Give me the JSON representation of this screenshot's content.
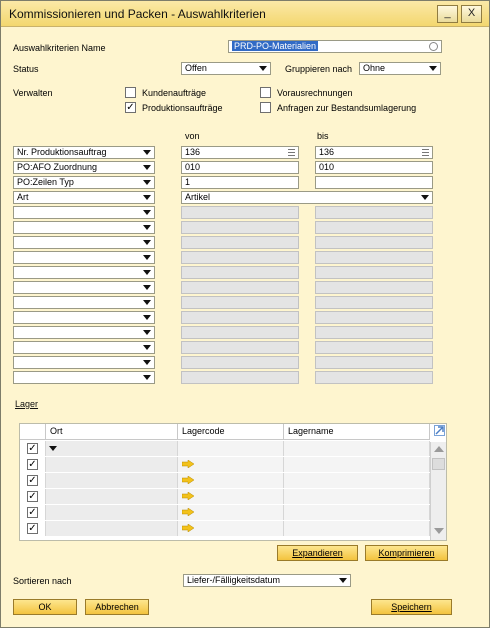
{
  "window": {
    "title": "Kommissionieren und Packen - Auswahlkriterien",
    "minimize": "_",
    "close": "X"
  },
  "criteria_name": {
    "label": "Auswahlkriterien Name",
    "value": "PRD-PO-Materialien"
  },
  "status": {
    "label": "Status",
    "value": "Offen"
  },
  "group": {
    "label": "Gruppieren nach",
    "value": "Ohne"
  },
  "manage": {
    "label": "Verwalten",
    "options": [
      {
        "label": "Kundenaufträge",
        "checked": false
      },
      {
        "label": "Produktionsaufträge",
        "checked": true
      },
      {
        "label": "Vorausrechnungen",
        "checked": false
      },
      {
        "label": "Anfragen zur Bestandsumlagerung",
        "checked": false
      }
    ]
  },
  "range": {
    "from_label": "von",
    "to_label": "bis",
    "rows": [
      {
        "field": "Nr. Produktionsauftrag",
        "from": "136",
        "to": "136"
      },
      {
        "field": "PO:AFO Zuordnung",
        "from": "010",
        "to": "010"
      },
      {
        "field": "PO:Zeilen Typ",
        "from": "1",
        "to": ""
      },
      {
        "field": "Art",
        "value": "Artikel"
      }
    ]
  },
  "warehouse": {
    "label": "Lager",
    "columns": [
      "Ort",
      "Lagercode",
      "Lagername"
    ],
    "rows": 6
  },
  "buttons": {
    "expand": "Expandieren",
    "compress": "Komprimieren",
    "ok": "OK",
    "cancel": "Abbrechen",
    "save": "Speichern"
  },
  "sort": {
    "label": "Sortieren nach",
    "value": "Liefer-/Fälligkeitsdatum"
  }
}
